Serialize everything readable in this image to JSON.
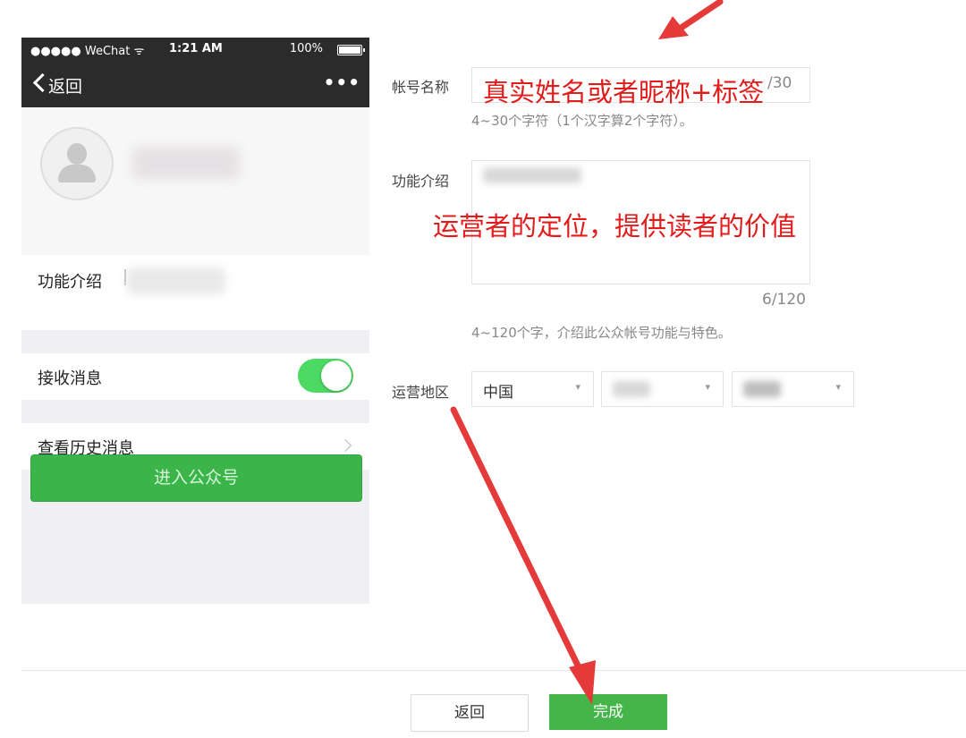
{
  "phone": {
    "status_bar": {
      "carrier": "●●●●● WeChat ᯤ",
      "time": "1:21 AM",
      "battery": "100%"
    },
    "nav": {
      "back_label": "返回",
      "more_icon": "•••"
    },
    "intro_label": "功能介绍",
    "receive_messages_label": "接收消息",
    "receive_messages_on": true,
    "history_label": "查看历史消息",
    "enter_button_label": "进入公众号"
  },
  "form": {
    "account_name_label": "帐号名称",
    "account_name_counter": "/30",
    "account_name_hint": "4~30个字符（1个汉字算2个字符）。",
    "intro_label": "功能介绍",
    "intro_counter": "6/120",
    "intro_hint": "4~120个字，介绍此公众帐号功能与特色。",
    "region_label": "运营地区",
    "region_country": "中国"
  },
  "annotations": {
    "name_note": "真实姓名或者昵称+标签",
    "intro_note": "运营者的定位，提供读者的价值"
  },
  "footer": {
    "back_label": "返回",
    "done_label": "完成"
  },
  "colors": {
    "accent_green": "#44b549",
    "annotation_red": "#e21b1b"
  }
}
